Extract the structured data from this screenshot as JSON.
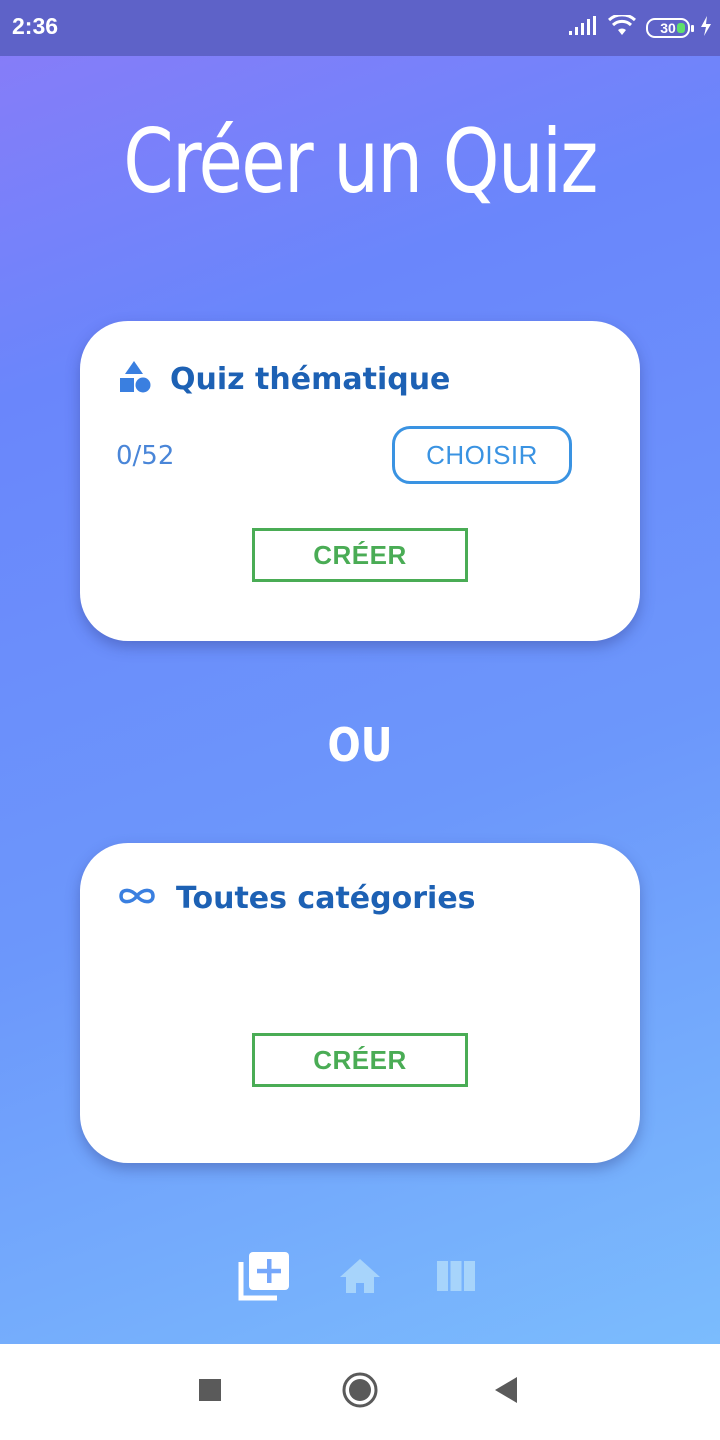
{
  "status_bar": {
    "time": "2:36",
    "battery": "30",
    "battery_color": "#5fe06b"
  },
  "title": "Créer un Quiz",
  "cards": [
    {
      "title": "Quiz thématique",
      "icon": "shapes-icon",
      "count": "0/52",
      "choose_label": "CHOISIR",
      "create_label": "CRÉER"
    },
    {
      "title": "Toutes catégories",
      "icon": "infinity-icon",
      "create_label": "CRÉER"
    }
  ],
  "separator": "OU",
  "bottom_nav": {
    "items": [
      {
        "icon": "add-to-library-icon",
        "active": true
      },
      {
        "icon": "home-icon",
        "active": false
      },
      {
        "icon": "view-column-icon",
        "active": false
      }
    ]
  },
  "system_nav": {
    "items": [
      "recent-apps-icon",
      "home-circle-icon",
      "back-triangle-icon"
    ]
  },
  "colors": {
    "title_blue": "#1d61b4",
    "choose_blue": "#3a93e2",
    "create_green": "#4aac55"
  }
}
